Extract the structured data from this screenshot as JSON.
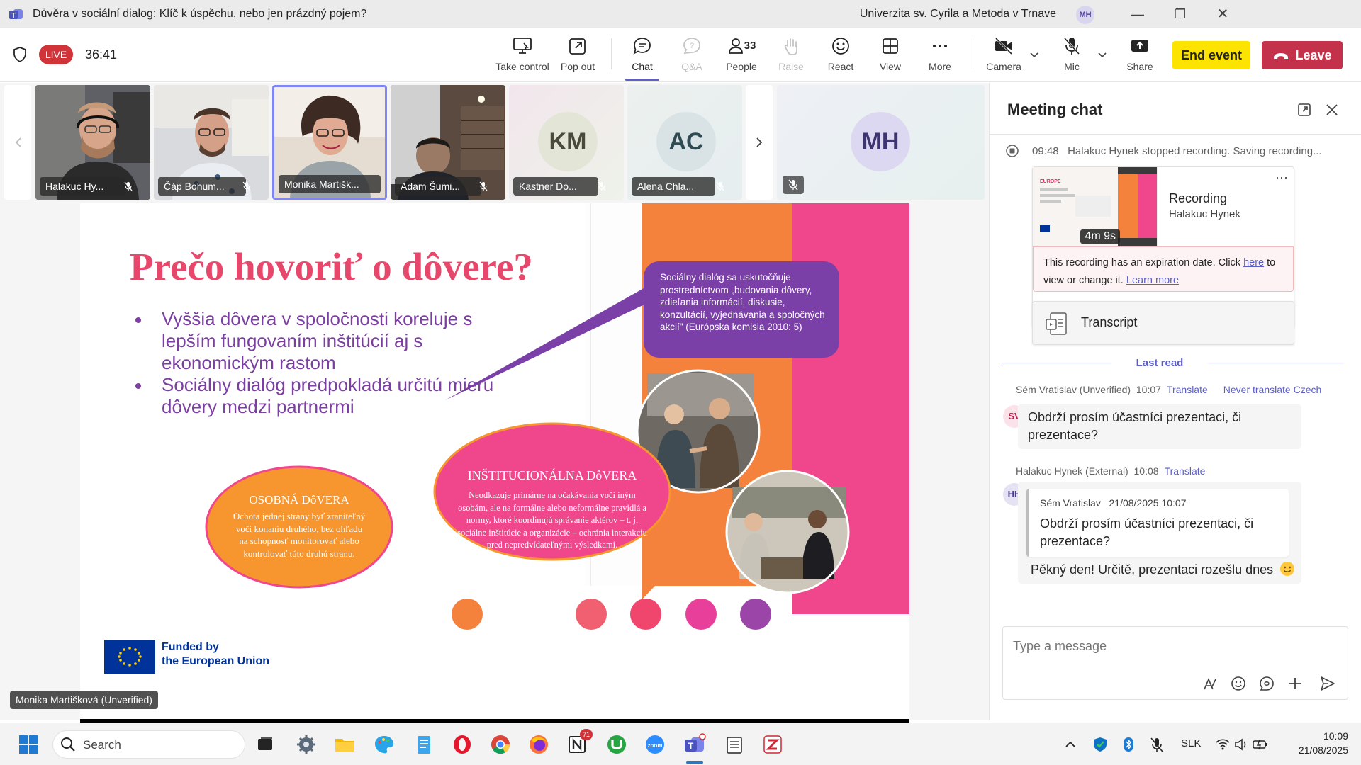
{
  "window": {
    "title": "Důvěra v sociální dialog: Klíč k úspěchu, nebo jen prázdný pojem?",
    "org": "Univerzita sv. Cyrila a Metoda v Trnave",
    "user_initials": "MH",
    "more": "···"
  },
  "toolbar": {
    "live": "LIVE",
    "timer": "36:41",
    "take_control": "Take control",
    "pop_out": "Pop out",
    "chat": "Chat",
    "qa": "Q&A",
    "people": "People",
    "people_count": "33",
    "raise": "Raise",
    "react": "React",
    "view": "View",
    "more": "More",
    "camera": "Camera",
    "mic": "Mic",
    "share": "Share",
    "end_event": "End event",
    "leave": "Leave"
  },
  "participants": [
    {
      "name": "Halakuc Hy...",
      "type": "video"
    },
    {
      "name": "Čáp Bohum...",
      "type": "video"
    },
    {
      "name": "Monika Martišk...",
      "type": "video",
      "active": true
    },
    {
      "name": "Adam Šumi...",
      "type": "video"
    },
    {
      "name": "Kastner Do...",
      "initials": "KM",
      "type": "avatar"
    },
    {
      "name": "Alena Chla...",
      "initials": "AC",
      "type": "avatar"
    },
    {
      "name": "",
      "initials": "MH",
      "type": "self"
    }
  ],
  "presenter_label": "Monika Martišková (Unverified)",
  "slide": {
    "title": "Prečo hovoriť o dôvere?",
    "bullets": [
      "Vyššia dôvera v spoločnosti koreluje s lepším fungovaním inštitúcií aj s ekonomickým rastom",
      "Sociálny dialóg predpokladá určitú mieru dôvery medzi partnermi"
    ],
    "quote": "Sociálny dialóg sa uskutočňuje prostredníctvom „budovania dôvery, zdieľania informácií, diskusie, konzultácií, vyjednávania a spoločných akcií\" (Európska komisia 2010: 5)",
    "oval1_title": "OSOBNÁ DôVERA",
    "oval1_text": "Ochota jednej strany byť zraniteľný voči konaniu druhého, bez ohľadu na schopnosť monitorovať alebo kontrolovať túto druhú stranu.",
    "oval2_title": "INŠTITUCIONÁLNA DôVERA",
    "oval2_text": "Neodkazuje primárne na očakávania voči iným osobám, ale na formálne alebo neformálne pravidlá a normy, ktoré koordinujú správanie aktérov – t. j. sociálne inštitúcie a organizácie – ochránia interakciu pred nepredvídateľnými výsledkami.",
    "eu_line1": "Funded by",
    "eu_line2": "the European Union",
    "colors": {
      "title": "#e8476c",
      "bullets": "#7a3fa0",
      "orange": "#f5823c",
      "pink": "#f0468c",
      "quote": "#7b3fa8"
    }
  },
  "chat": {
    "title": "Meeting chat",
    "system_time": "09:48",
    "system_text": "Halakuc Hynek stopped recording. Saving recording...",
    "recording_title": "Recording",
    "recording_author": "Halakuc Hynek",
    "recording_duration": "4m 9s",
    "recording_more": "···",
    "expiry_text": "This recording has an expiration date. Click",
    "expiry_link_here": "here",
    "expiry_text2": "to view or change it.",
    "expiry_learn_more": "Learn more",
    "transcript": "Transcript",
    "last_read": "Last read",
    "messages": [
      {
        "author": "Sém Vratislav (Unverified)",
        "time": "10:07",
        "translate": "Translate",
        "never": "Never translate Czech",
        "initials": "SV",
        "text": "Obdrží prosím účastníci prezentaci, či prezentace?"
      },
      {
        "author": "Halakuc Hynek (External)",
        "time": "10:08",
        "translate": "Translate",
        "initials": "HH",
        "quote_author": "Sém Vratislav",
        "quote_time": "21/08/2025 10:07",
        "quote_text": "Obdrží prosím účastníci prezentaci, či prezentace?",
        "text": "Pěkný den! Určitě, prezentaci rozešlu dnes"
      }
    ],
    "placeholder": "Type a message"
  },
  "taskbar": {
    "search": "Search",
    "lang": "SLK",
    "time": "10:09",
    "date": "21/08/2025",
    "notion_badge": "71"
  }
}
